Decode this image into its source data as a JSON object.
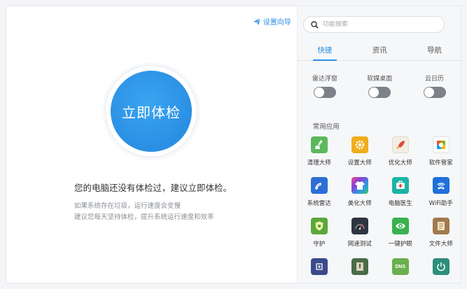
{
  "guide": {
    "label": "设置向导",
    "color": "#2f8ee6"
  },
  "main": {
    "button_label": "立即体检",
    "message": "您的电脑还没有体检过，建议立即体检。",
    "sub1": "如果系统存在垃圾，运行速度会变慢",
    "sub2": "建议您每天坚持体检，提升系统运行速度和效率",
    "accent": "#2a8fe3"
  },
  "search": {
    "placeholder": "功能搜索",
    "value": ""
  },
  "tabs": [
    {
      "label": "快捷",
      "active": true
    },
    {
      "label": "资讯",
      "active": false
    },
    {
      "label": "导航",
      "active": false
    }
  ],
  "toggles": [
    {
      "label": "雷达浮窗",
      "on": false
    },
    {
      "label": "软媒桌面",
      "on": false
    },
    {
      "label": "云日历",
      "on": false
    }
  ],
  "apps_title": "常用应用",
  "apps": [
    {
      "label": "清理大师",
      "icon": "broom-icon",
      "color": "#5cb85c"
    },
    {
      "label": "设置大师",
      "icon": "gear-icon",
      "color": "#f0ad1c"
    },
    {
      "label": "优化大师",
      "icon": "rocket-icon",
      "color": "#f3eee3"
    },
    {
      "label": "软件管家",
      "icon": "software-store-icon",
      "color": "#ffffff"
    },
    {
      "label": "系统雷达",
      "icon": "radar-icon",
      "color": "#2d6fd6"
    },
    {
      "label": "美化大师",
      "icon": "tshirt-icon",
      "color": "#c63fc6"
    },
    {
      "label": "电脑医生",
      "icon": "medical-kit-icon",
      "color": "#1bb4a5"
    },
    {
      "label": "WiFi助手",
      "icon": "wifi-users-icon",
      "color": "#1f6fd9"
    },
    {
      "label": "守护",
      "icon": "shield-icon",
      "color": "#5aa83a"
    },
    {
      "label": "网速测试",
      "icon": "speedometer-icon",
      "color": "#2d3540"
    },
    {
      "label": "一键护眼",
      "icon": "eye-icon",
      "color": "#37b24d"
    },
    {
      "label": "文件大师",
      "icon": "file-icon",
      "color": "#a07a50"
    },
    {
      "label": "",
      "icon": "memory-chip-icon",
      "color": "#3b4a8a"
    },
    {
      "label": "",
      "icon": "archive-icon",
      "color": "#4a6b4a"
    },
    {
      "label": "",
      "icon": "dns-icon",
      "color": "#6ab04c"
    },
    {
      "label": "",
      "icon": "power-timer-icon",
      "color": "#2c8f7a"
    }
  ]
}
